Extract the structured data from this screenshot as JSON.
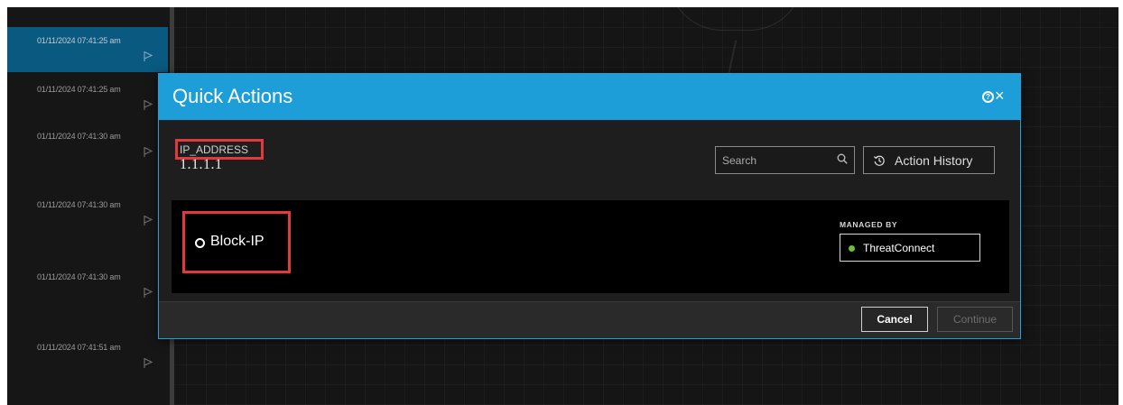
{
  "timeline": {
    "items": [
      {
        "time": "01/11/2024 07:41:25 am",
        "selected": true
      },
      {
        "time": "01/11/2024 07:41:25 am",
        "selected": false
      },
      {
        "time": "01/11/2024 07:41:30 am",
        "selected": false
      },
      {
        "time": "01/11/2024 07:41:30 am",
        "selected": false
      },
      {
        "time": "01/11/2024 07:41:30 am",
        "selected": false
      },
      {
        "time": "01/11/2024 07:41:51 am",
        "selected": false
      }
    ],
    "flag_icon": "flag-outline-icon"
  },
  "modal": {
    "title": "Quick Actions",
    "help_icon": "help-circle-icon",
    "close_icon": "close-icon",
    "target": {
      "type": "IP_ADDRESS",
      "value": "1.1.1.1"
    },
    "search": {
      "placeholder": "Search",
      "value": "",
      "icon": "search-icon"
    },
    "action_history": {
      "label": "Action History",
      "icon": "history-icon"
    },
    "action": {
      "label": "Block-IP",
      "selected": false
    },
    "managed_by": {
      "label": "MANAGED BY",
      "name": "ThreatConnect",
      "status_color": "#6bbf3a"
    },
    "footer": {
      "cancel_label": "Cancel",
      "continue_label": "Continue",
      "continue_enabled": false
    }
  },
  "colors": {
    "header_blue": "#1d9ed8",
    "selected_blue": "#0d6d9e",
    "highlight_red": "#e03a3e",
    "background": "#1a1a1a"
  }
}
